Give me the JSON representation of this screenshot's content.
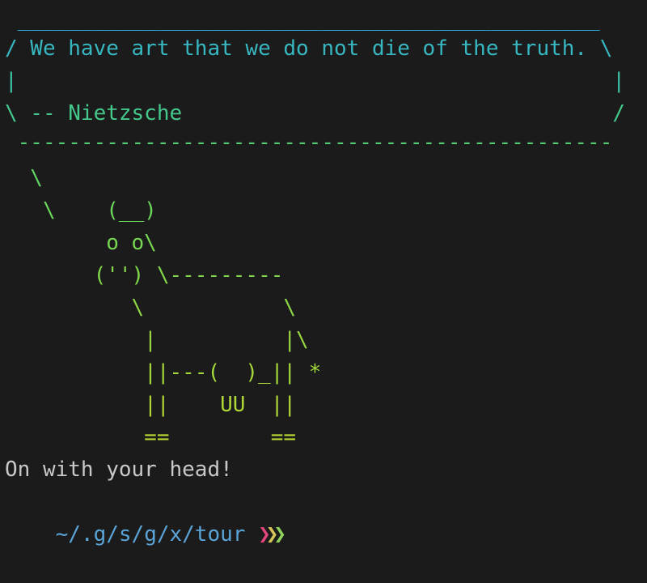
{
  "quote": {
    "top_border": " ______________________________________________",
    "line1": "/ We have art that we do not die of the truth. \\",
    "line2": "|                                               |",
    "line3": "\\ -- Nietzsche                                  /",
    "bottom_border": " -----------------------------------------------"
  },
  "art": {
    "lines": [
      "  \\",
      "   \\    (__)",
      "        o o\\",
      "       ('') \\---------",
      "          \\           \\",
      "           |          |\\",
      "           ||---(  )_|| *",
      "           ||    UU  ||",
      "           ==        =="
    ]
  },
  "message": "On with your head!",
  "prompt": {
    "path": "~/.g/s/g/x/tour",
    "chevrons": [
      "❯",
      "❯",
      "❯"
    ],
    "chevron_colors": [
      "#e0457b",
      "#d6c35a",
      "#8fd15c"
    ]
  },
  "colors": {
    "gradient": [
      "#22a8d8",
      "#3cc0b0",
      "#5cd46a",
      "#9ad640",
      "#c0d830"
    ],
    "message": "#c9c9c9",
    "path": "#5aa4d8",
    "background": "#1b1b1b"
  }
}
